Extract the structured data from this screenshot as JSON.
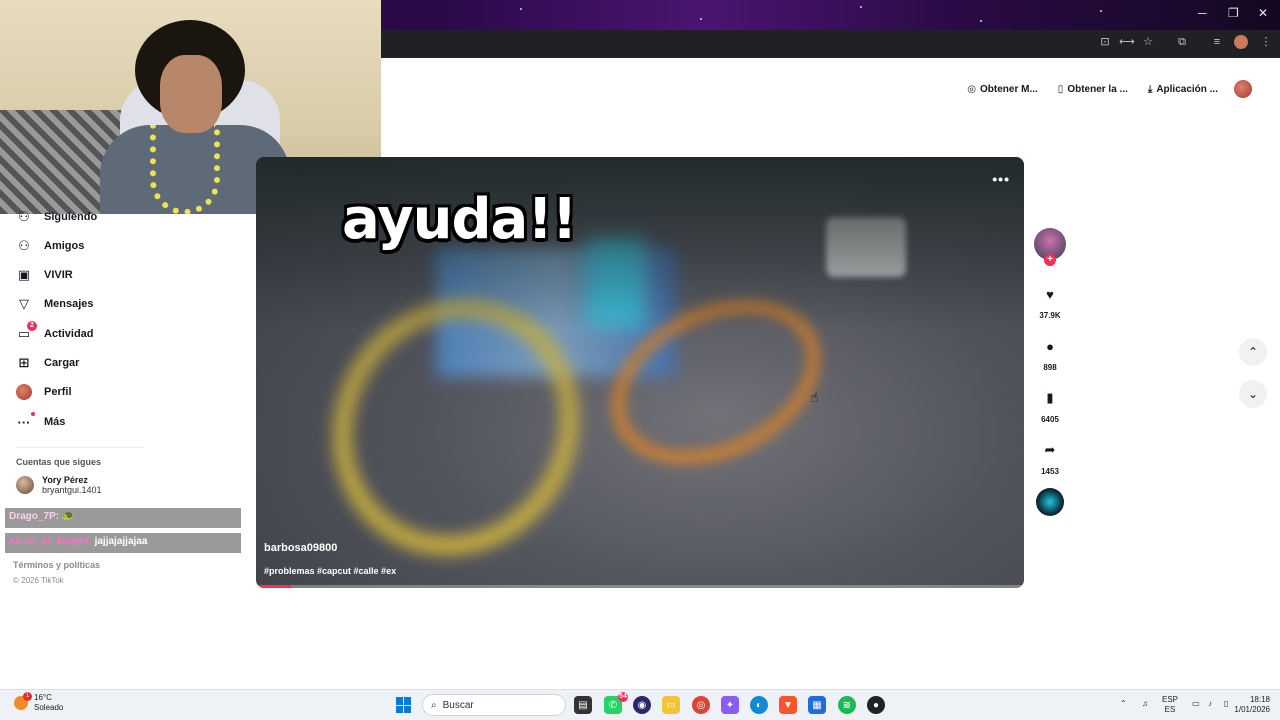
{
  "browser": {
    "window_controls": [
      "─",
      "❐",
      "✕"
    ],
    "toolbar_icons": [
      "install-icon",
      "translate-icon",
      "bookmark-star-icon",
      "extensions-icon",
      "media-icon",
      "profile-icon",
      "menu-icon"
    ]
  },
  "header": {
    "actions": [
      {
        "label": "Obtener M...",
        "icon": "coin-icon"
      },
      {
        "label": "Obtener la ...",
        "icon": "phone-icon"
      },
      {
        "label": "Aplicación ...",
        "icon": "download-icon"
      }
    ]
  },
  "sidebar": {
    "items": [
      {
        "label": "Siguiendo",
        "icon": "following-icon"
      },
      {
        "label": "Amigos",
        "icon": "friends-icon"
      },
      {
        "label": "VIVIR",
        "icon": "live-icon"
      },
      {
        "label": "Mensajes",
        "icon": "messages-icon"
      },
      {
        "label": "Actividad",
        "icon": "activity-icon",
        "badge": "2"
      },
      {
        "label": "Cargar",
        "icon": "upload-icon"
      },
      {
        "label": "Perfil",
        "icon": "profile-avatar"
      },
      {
        "label": "Más",
        "icon": "more-icon"
      }
    ],
    "following_title": "Cuentas que sigues",
    "following": [
      {
        "name": "Yory Pérez",
        "handle": "bryantgui.1401"
      }
    ],
    "footer_links": "Términos y políticas",
    "copyright": "© 2026 TikTok"
  },
  "chat_overlay": [
    {
      "user": "Drago_7P:",
      "message": "🐢"
    },
    {
      "user": "aaron_tu_king64:",
      "message": "jajjajajjajaa"
    }
  ],
  "video": {
    "overlay_text": "ayuda!!",
    "more": "•••",
    "author": "barbosa09800",
    "hashtags": "#problemas #capcut #calle #ex",
    "progress": 0.045
  },
  "actions": {
    "likes": "37.9K",
    "comments": "898",
    "saves": "6405",
    "shares": "1453"
  },
  "taskbar": {
    "temperature": "16°C",
    "condition": "Soleado",
    "weather_badge": "1",
    "search_placeholder": "Buscar",
    "whatsapp_badge": "54",
    "lang_top": "ESP",
    "lang_bottom": "ES",
    "time": "18:18",
    "date": "1/01/2026"
  },
  "colors": {
    "accent": "#fe2c55",
    "taskbar": "#eef1f6"
  }
}
